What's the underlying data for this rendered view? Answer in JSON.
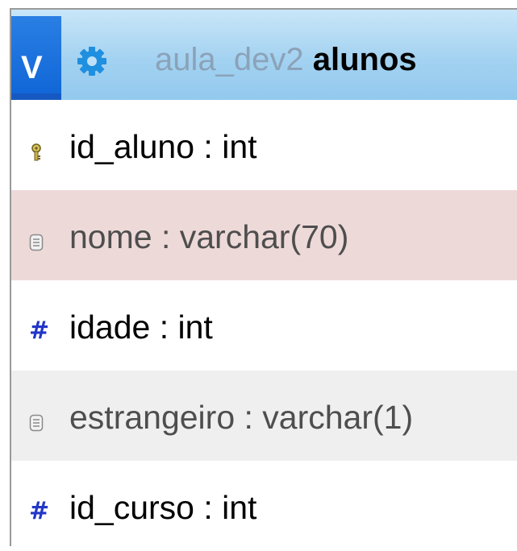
{
  "table": {
    "toggle_label": "V",
    "database": "aula_dev2",
    "name": "alunos",
    "columns": [
      {
        "label": "id_aluno : int",
        "icon": "primary-key-icon",
        "bg": "#ffffff",
        "color": "#000000"
      },
      {
        "label": "nome : varchar(70)",
        "icon": "text-field-icon",
        "bg": "#eed9d9",
        "color": "#4e4e4e"
      },
      {
        "label": "idade : int",
        "icon": "numeric-field-icon",
        "bg": "#ffffff",
        "color": "#000000"
      },
      {
        "label": "estrangeiro : varchar(1)",
        "icon": "text-field-icon",
        "bg": "#efefef",
        "color": "#4e4e4e"
      },
      {
        "label": "id_curso : int",
        "icon": "numeric-field-icon",
        "bg": "#ffffff",
        "color": "#000000"
      }
    ]
  },
  "colors": {
    "header_bg": "#a3d2f1",
    "toggle_bg": "#1565d8",
    "gear": "#1f8fe0",
    "numeric_icon": "#2236c7"
  }
}
